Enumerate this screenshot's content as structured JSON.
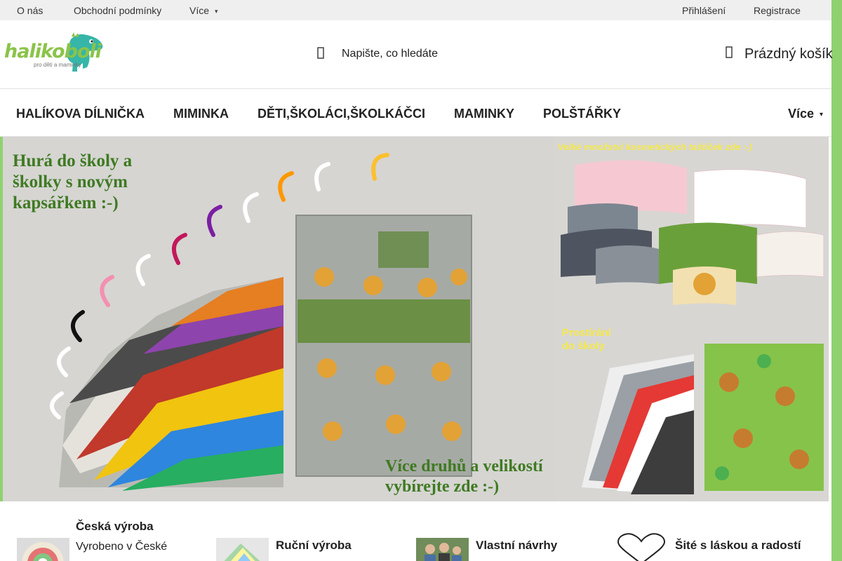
{
  "topbar": {
    "links": [
      "O nás",
      "Obchodní podmínky"
    ],
    "more": "Více",
    "login": "Přihlášení",
    "register": "Registrace"
  },
  "header": {
    "logo_text": "halikoboli",
    "logo_tagline": "pro děti a maminky",
    "search_placeholder": "Napište, co hledáte",
    "cart_label": "Prázdný košík"
  },
  "nav": {
    "items": [
      "HALÍKOVA DÍLNIČKA",
      "MIMINKA",
      "DĚTI,ŠKOLÁCI,ŠKOLKÁČCI",
      "MAMINKY",
      "POLŠTÁŘKY"
    ],
    "more": "Více"
  },
  "banner": {
    "main_headline": [
      "Hurá do školy a",
      "školky s novým",
      "kapsářkem :-)"
    ],
    "main_footer": [
      "Více druhů a velikostí",
      "vybírejte zde :-)"
    ],
    "top_right_caption": "Velké množství kosmetických taštiček zde :-)",
    "bottom_right_caption": [
      "Prostírání",
      "do školy"
    ]
  },
  "benefits": [
    {
      "title": "Česká výroba",
      "text": "Vyrobeno v České"
    },
    {
      "title": "Ruční výroba"
    },
    {
      "title": "Vlastní návrhy"
    },
    {
      "title": "Šité s láskou a radostí"
    }
  ],
  "icons": {
    "search": "search-icon",
    "cart": "cart-icon",
    "heart": "heart-icon",
    "chevron": "chevron-down-icon"
  },
  "colors": {
    "brand_green": "#8bc34a",
    "banner_text_green": "#3f7a22",
    "caption_yellow": "#f5e94a"
  }
}
